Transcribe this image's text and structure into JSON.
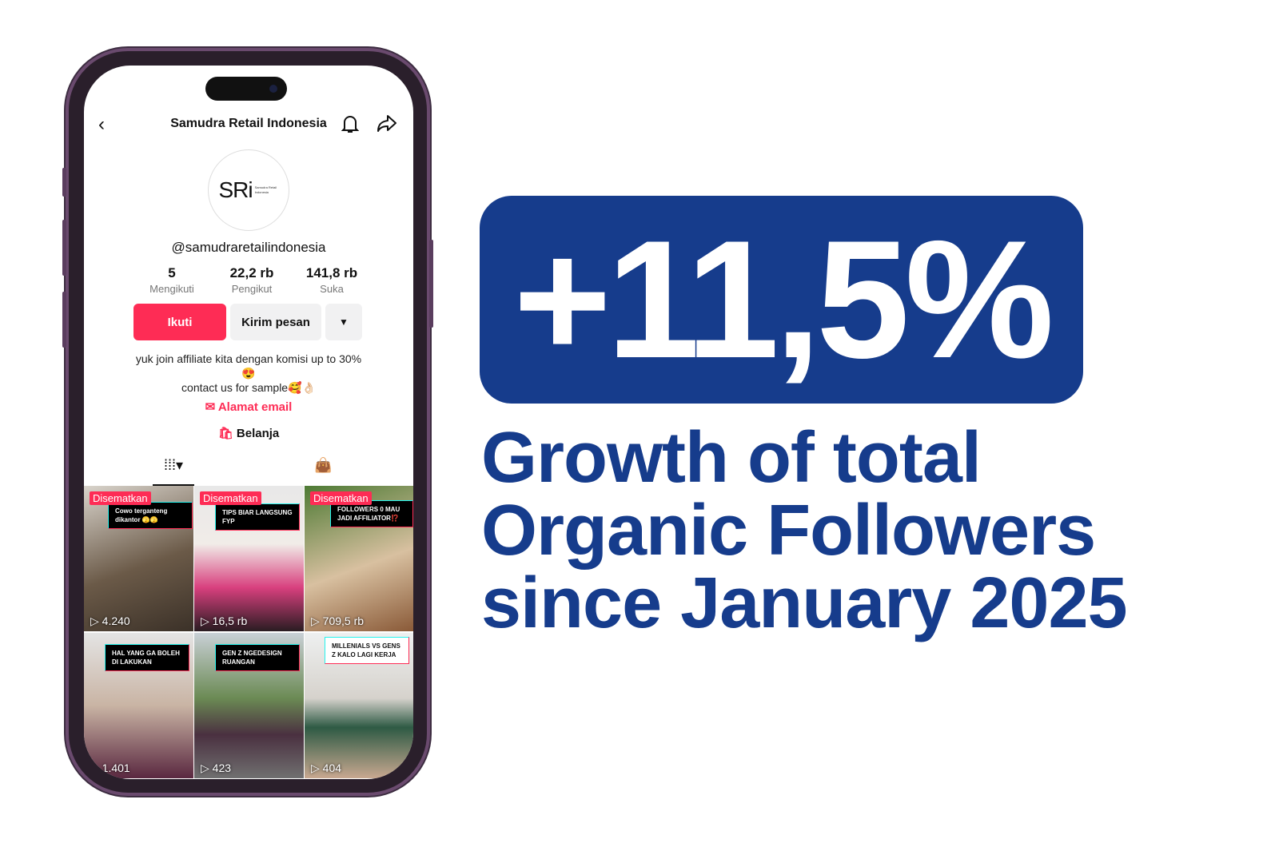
{
  "phone": {
    "header": {
      "title": "Samudra Retail Indonesia"
    },
    "profile": {
      "logo_text": "SRi",
      "logo_small": "Samudra Retail Indonesia",
      "handle": "@samudraretailindonesia",
      "stats": [
        {
          "value": "5",
          "label": "Mengikuti"
        },
        {
          "value": "22,2 rb",
          "label": "Pengikut"
        },
        {
          "value": "141,8 rb",
          "label": "Suka"
        }
      ],
      "follow_label": "Ikuti",
      "message_label": "Kirim pesan",
      "bio_line1": "yuk join affiliate kita dengan komisi up to 30%",
      "bio_emoji": "😍",
      "bio_line2": "contact us for sample🥰👌🏻",
      "email_label": "Alamat email",
      "shop_label": "Belanja"
    },
    "videos": [
      {
        "pinned": "Disematkan",
        "caption": "Cowo terganteng dikantor 🫣🫣",
        "views": "4.240"
      },
      {
        "pinned": "Disematkan",
        "caption": "TIPS BIAR LANGSUNG FYP",
        "views": "16,5 rb"
      },
      {
        "pinned": "Disematkan",
        "caption": "FOLLOWERS 0 MAU JADI AFFILIATOR⁉️",
        "views": "709,5 rb"
      },
      {
        "pinned": "",
        "caption": "HAL YANG GA BOLEH DI LAKUKAN",
        "views": "1.401"
      },
      {
        "pinned": "",
        "caption": "GEN Z NGEDESIGN RUANGAN",
        "views": "423"
      },
      {
        "pinned": "",
        "caption": "MILLENIALS VS GENS Z KALO LAGI KERJA",
        "views": "404"
      }
    ]
  },
  "headline": {
    "stat": "+11,5%",
    "line1": "Growth of total",
    "line2": "Organic Followers",
    "line3": "since January 2025"
  },
  "colors": {
    "brand_blue": "#163c8c",
    "tiktok_red": "#fe2c55"
  }
}
